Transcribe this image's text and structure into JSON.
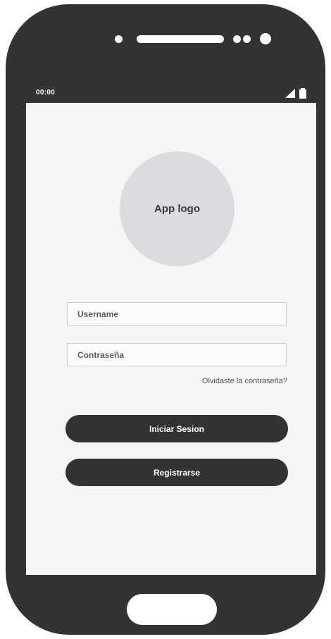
{
  "status_bar": {
    "time": "00:00"
  },
  "app_logo": {
    "label": "App logo"
  },
  "login_form": {
    "username_placeholder": "Username",
    "password_placeholder": "Contraseña",
    "forgot_password_label": "Olvidaste la contraseña?",
    "login_button_label": "Iniciar Sesion",
    "register_button_label": "Registrarse"
  },
  "icons": {
    "signal": "signal-icon",
    "battery": "battery-icon"
  },
  "colors": {
    "device_body": "#333333",
    "screen_background": "#f5f5f5",
    "logo_placeholder": "#dcdbe0",
    "button_background": "#333333",
    "button_text": "#ffffff"
  }
}
